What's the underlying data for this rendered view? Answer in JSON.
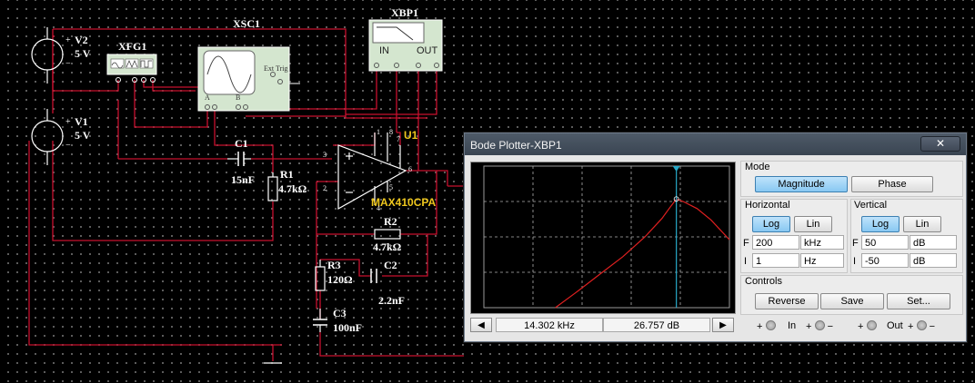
{
  "schematic": {
    "v2": {
      "name": "V2",
      "value": "5 V",
      "plus": "+",
      "minus": "−"
    },
    "v1": {
      "name": "V1",
      "value": "5 V",
      "plus": "+",
      "minus": "−"
    },
    "xfg1": "XFG1",
    "xsc1": "XSC1",
    "xsc1_ext_trig": "Ext Trig",
    "xsc1_a": "A",
    "xsc1_b": "B",
    "xbp1": "XBP1",
    "xbp1_in": "IN",
    "xbp1_out": "OUT",
    "c1": {
      "name": "C1",
      "value": "15nF"
    },
    "r1": {
      "name": "R1",
      "value": "4.7kΩ"
    },
    "u1": "U1",
    "opamp": "MAX410CPA",
    "r2": {
      "name": "R2",
      "value": "4.7kΩ"
    },
    "r3": {
      "name": "R3",
      "value": "120Ω"
    },
    "c2": {
      "name": "C2",
      "value": "2.2nF"
    },
    "c3": {
      "name": "C3",
      "value": "100nF"
    },
    "pins": {
      "p3": "3",
      "p2": "2",
      "p1": "1",
      "p8": "8",
      "p6": "6",
      "p7": "7",
      "p4": "4",
      "p5": "5"
    }
  },
  "bode": {
    "title": "Bode Plotter-XBP1",
    "close": "✕",
    "mode_label": "Mode",
    "magnitude_btn": "Magnitude",
    "phase_btn": "Phase",
    "horizontal_label": "Horizontal",
    "vertical_label": "Vertical",
    "log_btn": "Log",
    "lin_btn": "Lin",
    "h_f_label": "F",
    "h_f_value": "200",
    "h_f_unit": "kHz",
    "h_i_label": "I",
    "h_i_value": "1",
    "h_i_unit": "Hz",
    "v_f_label": "F",
    "v_f_value": "50",
    "v_f_unit": "dB",
    "v_i_label": "I",
    "v_i_value": "-50",
    "v_i_unit": "dB",
    "controls_label": "Controls",
    "reverse_btn": "Reverse",
    "save_btn": "Save",
    "set_btn": "Set...",
    "cursor_freq": "14.302 kHz",
    "cursor_gain": "26.757 dB",
    "in_label": "In",
    "out_label": "Out",
    "plus": "+",
    "minus": "−",
    "horizontal_mode": "Log",
    "vertical_mode": "Log",
    "display_mode": "Magnitude"
  },
  "chart_data": {
    "type": "line",
    "x_scale": "log",
    "x_range_hz": [
      1,
      200000
    ],
    "ylim": [
      -50,
      50
    ],
    "grid": true,
    "trace_color": "#e02020",
    "cursor_color": "#28a8c8",
    "cursor": {
      "x_hz": 14302,
      "y_db": 26.757
    },
    "series": [
      {
        "x": [
          35,
          100,
          300,
          1000,
          3000,
          7000,
          10000,
          14302,
          20000,
          40000,
          80000,
          200000
        ],
        "values": [
          -50,
          -39,
          -27,
          -14,
          0,
          13,
          20,
          26.757,
          25,
          20,
          12,
          -2
        ]
      }
    ]
  }
}
